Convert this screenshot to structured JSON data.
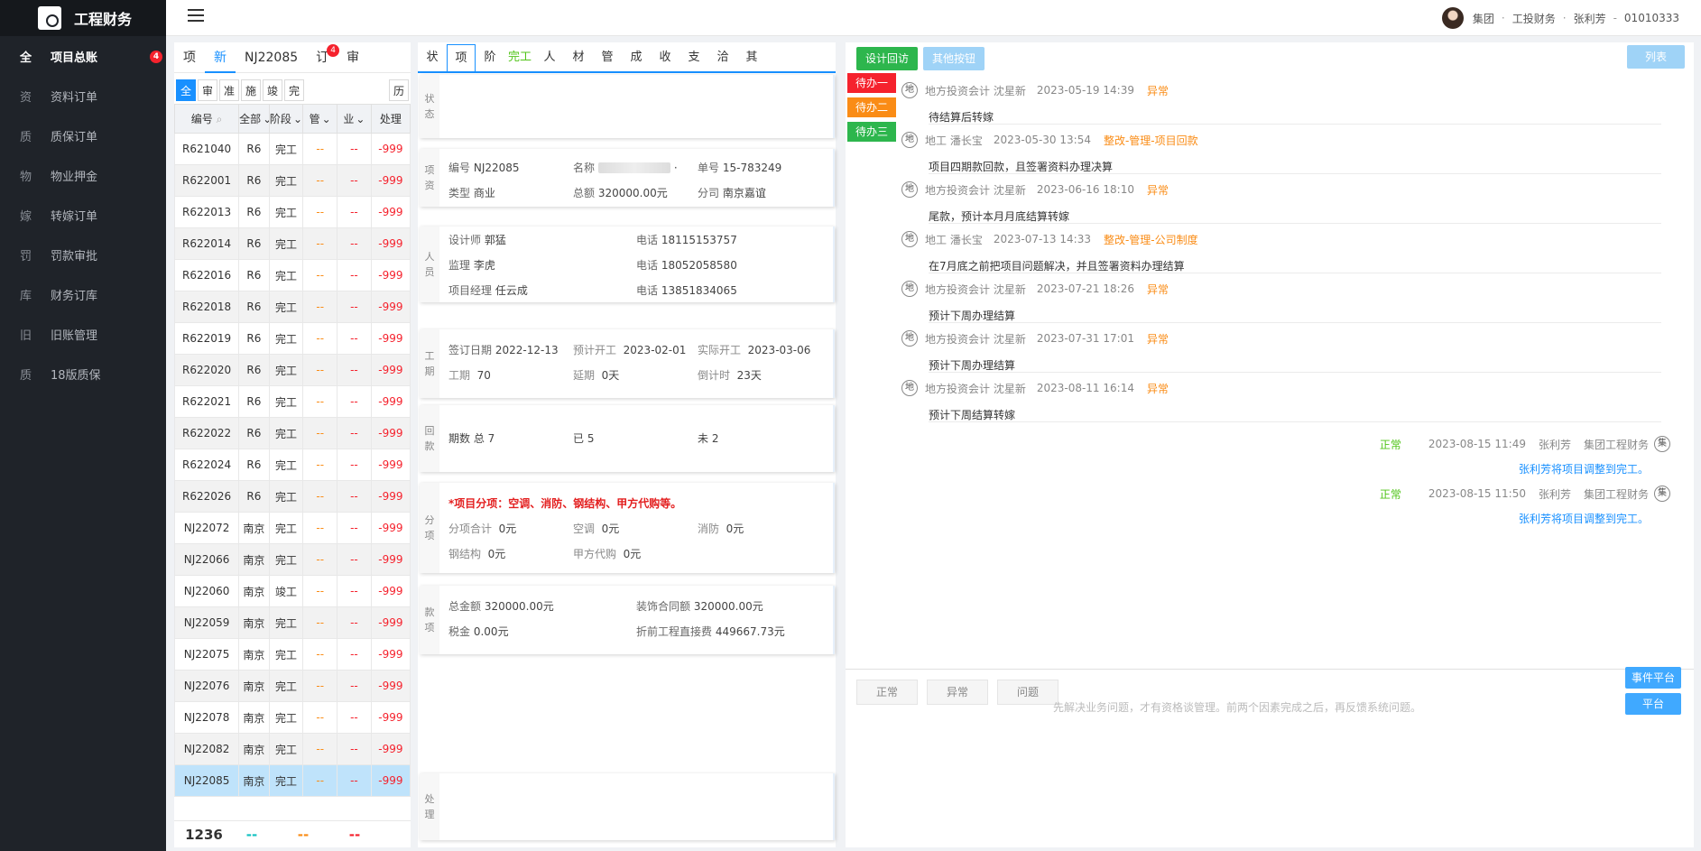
{
  "app": {
    "title": "工程财务"
  },
  "sidebar": {
    "items": [
      {
        "ch": "全",
        "label": "项目总账",
        "badge": "4",
        "active": true
      },
      {
        "ch": "资",
        "label": "资料订单"
      },
      {
        "ch": "质",
        "label": "质保订单"
      },
      {
        "ch": "物",
        "label": "物业押金"
      },
      {
        "ch": "嫁",
        "label": "转嫁订单"
      },
      {
        "ch": "罚",
        "label": "罚款审批"
      },
      {
        "ch": "库",
        "label": "财务订库"
      },
      {
        "ch": "旧",
        "label": "旧账管理"
      },
      {
        "ch": "质",
        "label": "18版质保"
      }
    ]
  },
  "header": {
    "org": "集团",
    "dept": "工投财务",
    "user": "张利芳",
    "dash": "-",
    "code": "01010333",
    "dot": "·"
  },
  "left": {
    "tabs": [
      {
        "label": "项"
      },
      {
        "label": "新",
        "active": true
      },
      {
        "label": "NJ22085"
      },
      {
        "label": "订",
        "badge": "4"
      },
      {
        "label": "审"
      }
    ],
    "filters": [
      "全",
      "审",
      "准",
      "施",
      "竣",
      "完"
    ],
    "history_label": "历",
    "columns": [
      "编号",
      "全部",
      "阶段",
      "管",
      "业",
      "处理"
    ],
    "rows": [
      [
        "R621040",
        "R6",
        "完工",
        "--",
        "--",
        "-999"
      ],
      [
        "R622001",
        "R6",
        "完工",
        "--",
        "--",
        "-999"
      ],
      [
        "R622013",
        "R6",
        "完工",
        "--",
        "--",
        "-999"
      ],
      [
        "R622014",
        "R6",
        "完工",
        "--",
        "--",
        "-999"
      ],
      [
        "R622016",
        "R6",
        "完工",
        "--",
        "--",
        "-999"
      ],
      [
        "R622018",
        "R6",
        "完工",
        "--",
        "--",
        "-999"
      ],
      [
        "R622019",
        "R6",
        "完工",
        "--",
        "--",
        "-999"
      ],
      [
        "R622020",
        "R6",
        "完工",
        "--",
        "--",
        "-999"
      ],
      [
        "R622021",
        "R6",
        "完工",
        "--",
        "--",
        "-999"
      ],
      [
        "R622022",
        "R6",
        "完工",
        "--",
        "--",
        "-999"
      ],
      [
        "R622024",
        "R6",
        "完工",
        "--",
        "--",
        "-999"
      ],
      [
        "R622026",
        "R6",
        "完工",
        "--",
        "--",
        "-999"
      ],
      [
        "NJ22072",
        "南京",
        "完工",
        "--",
        "--",
        "-999"
      ],
      [
        "NJ22066",
        "南京",
        "完工",
        "--",
        "--",
        "-999"
      ],
      [
        "NJ22060",
        "南京",
        "竣工",
        "--",
        "--",
        "-999"
      ],
      [
        "NJ22059",
        "南京",
        "完工",
        "--",
        "--",
        "-999"
      ],
      [
        "NJ22075",
        "南京",
        "完工",
        "--",
        "--",
        "-999"
      ],
      [
        "NJ22076",
        "南京",
        "完工",
        "--",
        "--",
        "-999"
      ],
      [
        "NJ22078",
        "南京",
        "完工",
        "--",
        "--",
        "-999"
      ],
      [
        "NJ22082",
        "南京",
        "完工",
        "--",
        "--",
        "-999"
      ],
      [
        "NJ22085",
        "南京",
        "完工",
        "--",
        "--",
        "-999"
      ]
    ],
    "selected_row": "NJ22085",
    "footer": {
      "total": "1236",
      "d1": "--",
      "d2": "--",
      "d3": "--"
    }
  },
  "mid": {
    "tabs": [
      "状",
      "项",
      "阶",
      "完工",
      "人",
      "材",
      "管",
      "成",
      "收",
      "支",
      "洽",
      "其"
    ],
    "active_tab": "项",
    "labels": {
      "status": "状态",
      "project": "项资",
      "people": "人员",
      "period": "工期",
      "payback": "回款",
      "sub": "分项",
      "money": "款项",
      "handle": "处理"
    },
    "project": {
      "no_k": "编号",
      "no": "NJ22085",
      "name_k": "名称",
      "name_tail": "·",
      "order_k": "单号",
      "order": "15-783249",
      "type_k": "类型",
      "type": "商业",
      "total_k": "总额",
      "total": "320000.00元",
      "branch_k": "分司",
      "branch": "南京嘉谊"
    },
    "people": {
      "designer_k": "设计师",
      "designer": "郭猛",
      "phone_k": "电话",
      "designer_phone": "18115153757",
      "sup_k": "监理",
      "sup": "李虎",
      "sup_phone": "18052058580",
      "pm_k": "项目经理",
      "pm": "任云成",
      "pm_phone": "13851834065"
    },
    "period": {
      "sign_k": "签订日期",
      "sign": "2022-12-13",
      "plan_k": "预计开工",
      "plan": "2023-02-01",
      "act_k": "实际开工",
      "act": "2023-03-06",
      "days_k": "工期",
      "days": "70",
      "delay_k": "延期",
      "delay": "0天",
      "count_k": "倒计时",
      "count": "23天"
    },
    "payback": {
      "total": "期数 总 7",
      "done": "已 5",
      "left": "未 2"
    },
    "sub": {
      "title": "*项目分项：空调、消防、钢结构、甲方代购等。",
      "sum_k": "分项合计",
      "sum": "0元",
      "ac_k": "空调",
      "ac": "0元",
      "fire_k": "消防",
      "fire": "0元",
      "steel_k": "钢结构",
      "steel": "0元",
      "buy_k": "甲方代购",
      "buy": "0元"
    },
    "money": {
      "total_k": "总金额",
      "total": "320000.00元",
      "deco_k": "装饰合同额",
      "deco": "320000.00元",
      "tax_k": "税金",
      "tax": "0.00元",
      "direct_k": "折前工程直接费",
      "direct": "449667.73元"
    }
  },
  "right": {
    "buttons": {
      "design": "设计回访",
      "other": "其他按钮",
      "list": "列表"
    },
    "todos": [
      "待办一",
      "待办二",
      "待办三"
    ],
    "events": [
      {
        "who": "地方投资会计 沈星新",
        "time": "2023-05-19 14:39",
        "tag": "异常",
        "text": "待结算后转嫁"
      },
      {
        "who": "地工 潘长宝",
        "time": "2023-05-30 13:54",
        "tag": "整改-管理-项目回款",
        "text": "项目四期款回款，且签署资料办理决算"
      },
      {
        "who": "地方投资会计 沈星新",
        "time": "2023-06-16 18:10",
        "tag": "异常",
        "text": "尾款，预计本月月底结算转嫁"
      },
      {
        "who": "地工 潘长宝",
        "time": "2023-07-13 14:33",
        "tag": "整改-管理-公司制度",
        "text": "在7月底之前把项目问题解决，并且签署资料办理结算"
      },
      {
        "who": "地方投资会计 沈星新",
        "time": "2023-07-21 18:26",
        "tag": "异常",
        "text": "预计下周办理结算"
      },
      {
        "who": "地方投资会计 沈星新",
        "time": "2023-07-31 17:01",
        "tag": "异常",
        "text": "预计下周办理结算"
      },
      {
        "who": "地方投资会计 沈星新",
        "time": "2023-08-11 16:14",
        "tag": "异常",
        "text": "预计下周结算转嫁"
      }
    ],
    "event_icon": "地",
    "replies": [
      {
        "status": "正常",
        "time": "2023-08-15 11:49",
        "user": "张利芳",
        "dept": "集团工程财务",
        "icon": "集",
        "text": "张利芳将项目调整到完工。"
      },
      {
        "status": "正常",
        "time": "2023-08-15 11:50",
        "user": "张利芳",
        "dept": "集团工程财务",
        "icon": "集",
        "text": "张利芳将项目调整到完工。"
      }
    ],
    "status_buttons": [
      "正常",
      "异常",
      "问题"
    ],
    "platform_buttons": [
      "事件平台",
      "平台"
    ],
    "hint": "先解决业务问题，才有资格谈管理。前两个因素完成之后，再反馈系统问题。"
  }
}
